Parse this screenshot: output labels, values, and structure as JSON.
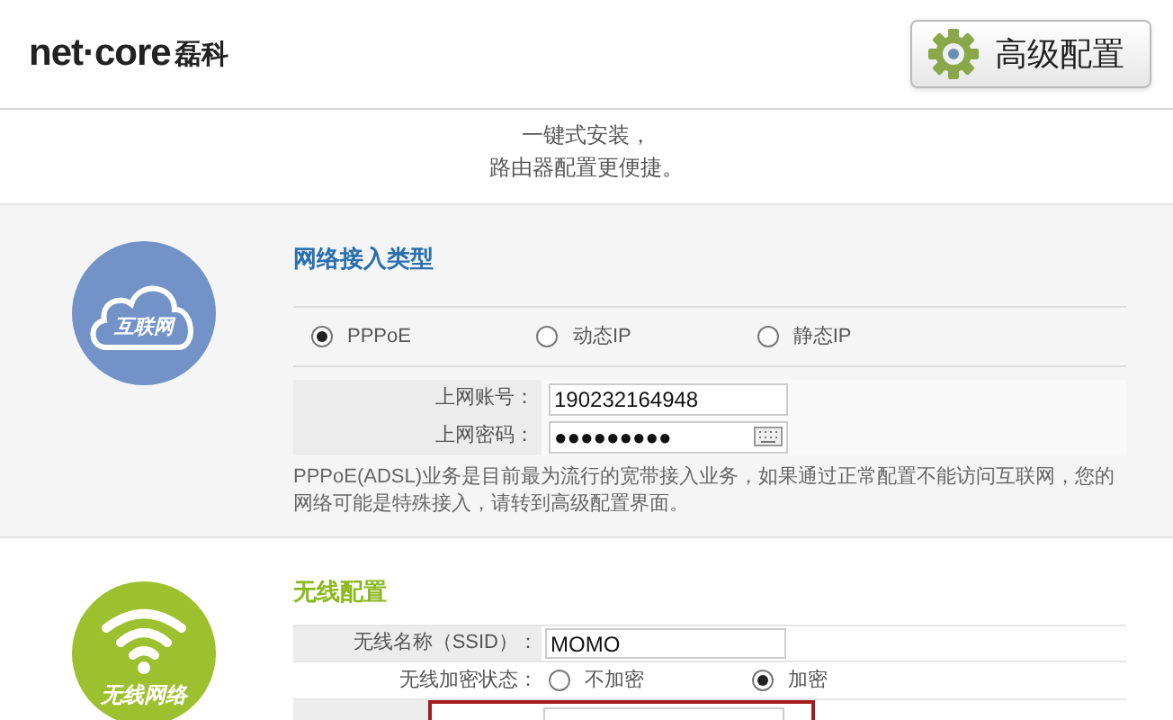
{
  "header": {
    "brand": "net·core",
    "brand_cn": "磊科",
    "advanced_button": "高级配置"
  },
  "intro": [
    "一键式安装，",
    "路由器配置更便捷。"
  ],
  "internet": {
    "icon_label": "互联网",
    "title": "网络接入类型",
    "options": [
      {
        "label": "PPPoE",
        "selected": true
      },
      {
        "label": "动态IP",
        "selected": false
      },
      {
        "label": "静态IP",
        "selected": false
      }
    ],
    "fields": [
      {
        "kind": "text",
        "label": "上网账号：",
        "value": "190232164948"
      },
      {
        "kind": "password",
        "label": "上网密码：",
        "value": "●●●●●●●●●"
      }
    ],
    "note": "PPPoE(ADSL)业务是目前最为流行的宽带接入业务，如果通过正常配置不能访问互联网，您的网络可能是特殊接入，请转到高级配置界面。"
  },
  "wireless": {
    "icon_label": "无线网络",
    "title": "无线配置",
    "ssid": {
      "label": "无线名称（SSID）：",
      "value": "MOMO"
    },
    "encryption": {
      "label": "无线加密状态：",
      "options": [
        {
          "label": "不加密",
          "selected": false
        },
        {
          "label": "加密",
          "selected": true
        }
      ]
    },
    "key_row": {
      "highlighted": true
    }
  }
}
